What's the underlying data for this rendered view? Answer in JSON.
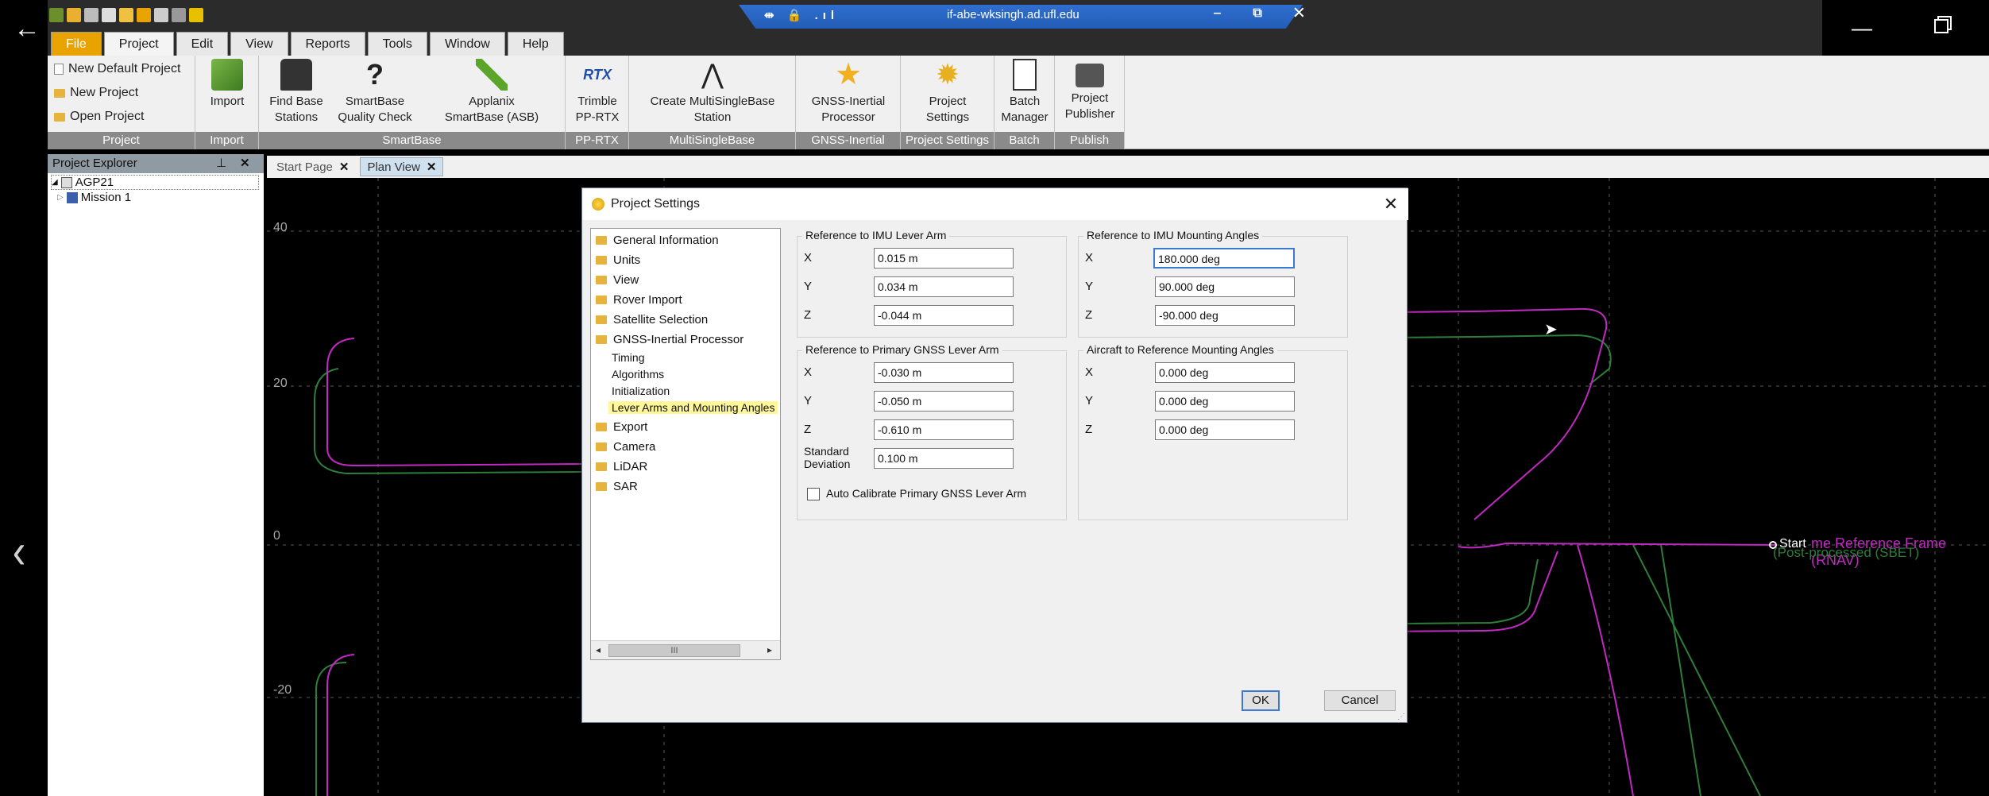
{
  "remote": {
    "host": "if-abe-wksingh.ad.ufl.edu",
    "bar_icons": "⇹ 🔒 .ıl",
    "bar_controls": "‒ ⧉ ✕",
    "back_arrow": "←",
    "left_chevron": "‹",
    "os_min": "—"
  },
  "menu": {
    "tabs": [
      "File",
      "Project",
      "Edit",
      "View",
      "Reports",
      "Tools",
      "Window",
      "Help"
    ],
    "active": "Project"
  },
  "ribbon": {
    "project_group": {
      "label": "Project",
      "new_default": "New Default Project",
      "new_project": "New Project",
      "open_project": "Open Project"
    },
    "import_group": {
      "label": "Import",
      "import": "Import"
    },
    "smartbase_group": {
      "label": "SmartBase",
      "find_base_1": "Find Base",
      "find_base_2": "Stations",
      "quality_1": "SmartBase",
      "quality_2": "Quality Check",
      "applanix_1": "Applanix",
      "applanix_2": "SmartBase (ASB)"
    },
    "pprtx_group": {
      "label": "PP-RTX",
      "trimble_1": "Trimble",
      "trimble_2": "PP-RTX",
      "rtx_logo": "RTX"
    },
    "multisinglebase_group": {
      "label": "MultiSingleBase",
      "create_1": "Create MultiSingleBase",
      "create_2": "Station"
    },
    "gnss_group": {
      "label": "GNSS-Inertial",
      "proc_1": "GNSS-Inertial",
      "proc_2": "Processor"
    },
    "settings_group": {
      "label": "Project Settings",
      "ps_1": "Project",
      "ps_2": "Settings"
    },
    "batch_group": {
      "label": "Batch",
      "bm_1": "Batch",
      "bm_2": "Manager"
    },
    "publish_group": {
      "label": "Publish",
      "pp_1": "Project",
      "pp_2": "Publisher"
    }
  },
  "explorer": {
    "title": "Project Explorer",
    "pin": "⊥",
    "close": "✕",
    "root": "AGP21",
    "child": "Mission 1"
  },
  "doc_tabs": {
    "start": "Start Page",
    "plan": "Plan View",
    "close": "✕"
  },
  "plan": {
    "y_ticks": [
      "40",
      "20",
      "0",
      "-20"
    ],
    "start_label": "Start",
    "legend_rnav": "me Reference Frame (RNAV)",
    "legend_sbet": "(Post-processed (SBET)",
    "colors": {
      "rnav": "#c228c2",
      "sbet": "#2e7d3a",
      "grid": "#5a5a5a"
    }
  },
  "dialog": {
    "title": "Project Settings",
    "close": "✕",
    "nav": {
      "items": [
        "General Information",
        "Units",
        "View",
        "Rover Import",
        "Satellite Selection",
        "GNSS-Inertial Processor"
      ],
      "sub_items": [
        "Timing",
        "Algorithms",
        "Initialization",
        "Lever Arms and Mounting Angles"
      ],
      "more_items": [
        "Export",
        "Camera",
        "LiDAR",
        "SAR"
      ],
      "selected": "Lever Arms and Mounting Angles",
      "scroll_thumb": "III",
      "scroll_left": "◂",
      "scroll_right": "▸"
    },
    "imu_lever": {
      "title": "Reference to IMU Lever Arm",
      "x_label": "X",
      "x": "0.015 m",
      "y_label": "Y",
      "y": "0.034 m",
      "z_label": "Z",
      "z": "-0.044 m"
    },
    "imu_mount": {
      "title": "Reference to IMU Mounting Angles",
      "x_label": "X",
      "x": "180.000 deg",
      "y_label": "Y",
      "y": "90.000 deg",
      "z_label": "Z",
      "z": "-90.000 deg"
    },
    "gnss_lever": {
      "title": "Reference to Primary GNSS Lever Arm",
      "x_label": "X",
      "x": "-0.030 m",
      "y_label": "Y",
      "y": "-0.050 m",
      "z_label": "Z",
      "z": "-0.610 m",
      "sd_label_1": "Standard",
      "sd_label_2": "Deviation",
      "sd": "0.100 m",
      "auto_calibrate": "Auto Calibrate Primary GNSS Lever Arm"
    },
    "aircraft_mount": {
      "title": "Aircraft to Reference Mounting Angles",
      "x_label": "X",
      "x": "0.000 deg",
      "y_label": "Y",
      "y": "0.000 deg",
      "z_label": "Z",
      "z": "0.000 deg"
    },
    "ok": "OK",
    "cancel": "Cancel"
  }
}
